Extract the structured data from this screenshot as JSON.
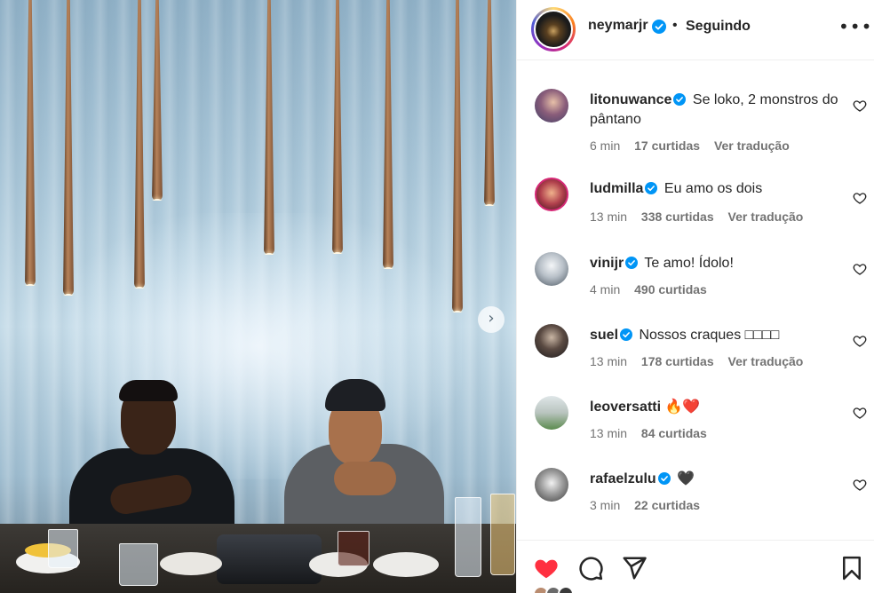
{
  "post": {
    "username": "neymarjr",
    "separator": "•",
    "follow_status": "Seguindo",
    "more_glyph": "•••"
  },
  "carousel": {
    "next_glyph": "›"
  },
  "comments": [
    {
      "user": "litonuwance",
      "verified": true,
      "text": "Se loko, 2 monstros do pântano",
      "time": "6 min",
      "likes": "17 curtidas",
      "translate": "Ver tradução"
    },
    {
      "user": "ludmilla",
      "verified": true,
      "text": "Eu amo os dois",
      "time": "13 min",
      "likes": "338 curtidas",
      "translate": "Ver tradução"
    },
    {
      "user": "vinijr",
      "verified": true,
      "text": "Te amo! Ídolo!",
      "time": "4 min",
      "likes": "490 curtidas",
      "translate": ""
    },
    {
      "user": "suel",
      "verified": true,
      "text": "Nossos craques □□□□",
      "time": "13 min",
      "likes": "178 curtidas",
      "translate": "Ver tradução"
    },
    {
      "user": "leoversatti",
      "verified": false,
      "text": "🔥❤️",
      "time": "13 min",
      "likes": "84 curtidas",
      "translate": ""
    },
    {
      "user": "rafaelzulu",
      "verified": true,
      "text": "🖤",
      "time": "3 min",
      "likes": "22 curtidas",
      "translate": ""
    }
  ],
  "colors": {
    "verified_blue": "#0095f6",
    "like_red": "#ff3040",
    "text_primary": "#262626",
    "text_secondary": "#737373"
  },
  "icons": {
    "like": "heart-icon",
    "comment": "comment-icon",
    "share": "paper-plane-icon",
    "save": "bookmark-icon",
    "more": "more-options-icon"
  }
}
